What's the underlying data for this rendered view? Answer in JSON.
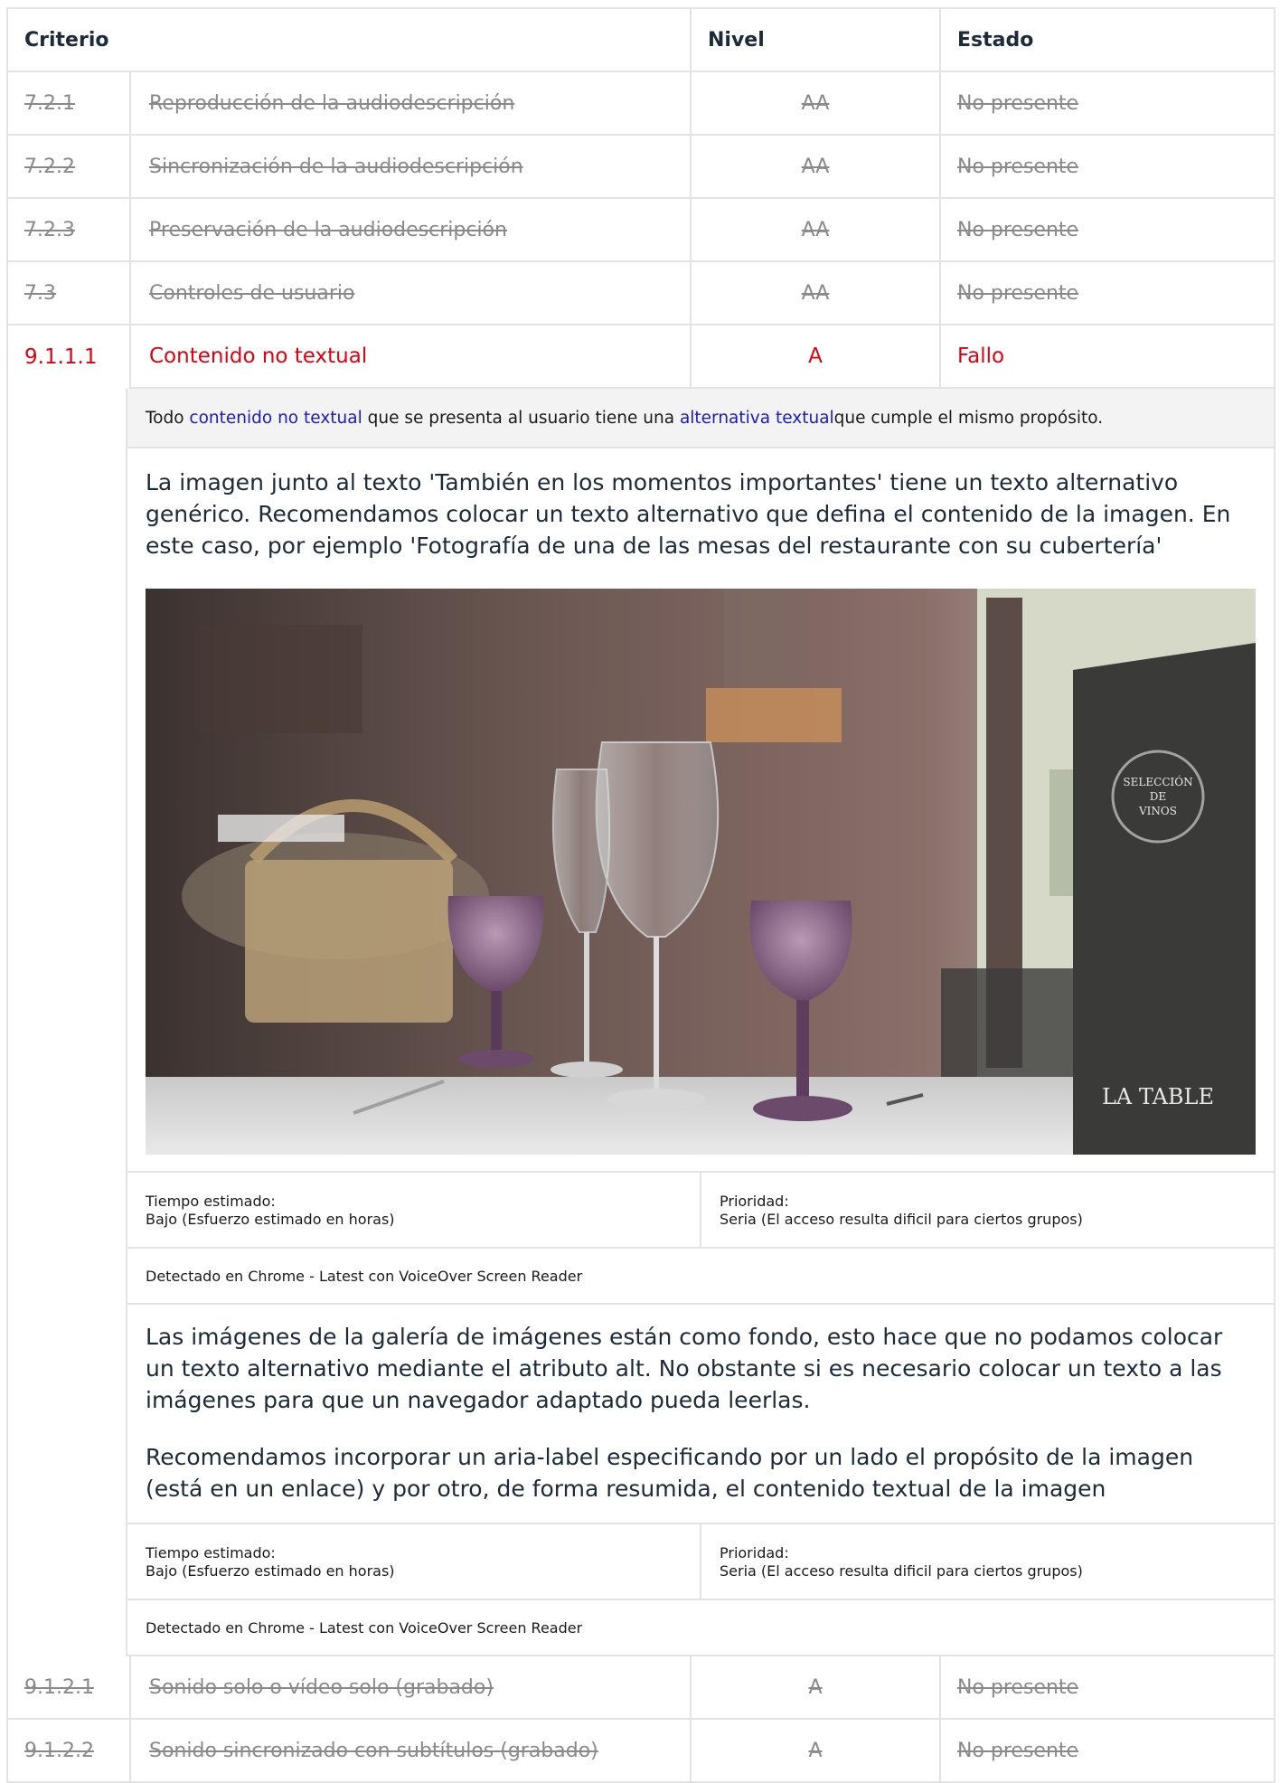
{
  "table": {
    "headers": {
      "criterion": "Criterio",
      "level": "Nivel",
      "status": "Estado"
    },
    "rows_before": [
      {
        "id": "7.2.1",
        "name": "Reproducción de la audiodescripción",
        "level": "AA",
        "status": "No presente"
      },
      {
        "id": "7.2.2",
        "name": "Sincronización de la audiodescripción",
        "level": "AA",
        "status": "No presente"
      },
      {
        "id": "7.2.3",
        "name": "Preservación de la audiodescripción",
        "level": "AA",
        "status": "No presente"
      },
      {
        "id": "7.3",
        "name": "Controles de usuario",
        "level": "AA",
        "status": "No presente"
      }
    ],
    "failed_row": {
      "id": "9.1.1.1",
      "name": "Contenido no textual",
      "level": "A",
      "status": "Fallo"
    },
    "definition": {
      "prefix": "Todo ",
      "link1": "contenido no textual",
      "middle": " que se presenta al usuario tiene una ",
      "link2": "alternativa textual",
      "suffix": " que cumple el mismo propósito."
    },
    "findings": [
      {
        "paragraphs": [
          "La imagen junto al texto 'También en los momentos importantes' tiene un texto alternativo genérico. Recomendamos colocar un texto alternativo que defina el contenido de la imagen. En este caso, por ejemplo 'Fotografía de una de las mesas del restaurante con su cubertería'"
        ],
        "photo_text": {
          "menu_line1": "SELECCIÓN",
          "menu_line2": "DE",
          "menu_line3": "VINOS",
          "brand": "LA TABLE"
        },
        "time_label": "Tiempo estimado:",
        "time_value": "Bajo (Esfuerzo estimado en horas)",
        "priority_label": "Prioridad:",
        "priority_value": "Seria (El acceso resulta dificil para ciertos grupos)",
        "detected": "Detectado en Chrome - Latest con VoiceOver Screen Reader"
      },
      {
        "paragraphs": [
          "Las imágenes de la galería de imágenes están como fondo, esto hace que no podamos colocar un texto alternativo mediante el atributo alt. No obstante si es necesario colocar un texto a las imágenes para que un navegador adaptado pueda leerlas.",
          "Recomendamos incorporar un aria-label especificando por un lado el propósito de la imagen (está en un enlace) y por otro, de forma resumida, el contenido textual de la imagen"
        ],
        "time_label": "Tiempo estimado:",
        "time_value": "Bajo (Esfuerzo estimado en horas)",
        "priority_label": "Prioridad:",
        "priority_value": "Seria (El acceso resulta dificil para ciertos grupos)",
        "detected": "Detectado en Chrome - Latest con VoiceOver Screen Reader"
      }
    ],
    "rows_after": [
      {
        "id": "9.1.2.1",
        "name": "Sonido solo o vídeo solo (grabado)",
        "level": "A",
        "status": "No presente"
      },
      {
        "id": "9.1.2.2",
        "name": "Sonido sincronizado con subtítulos (grabado)",
        "level": "A",
        "status": "No presente"
      }
    ]
  }
}
